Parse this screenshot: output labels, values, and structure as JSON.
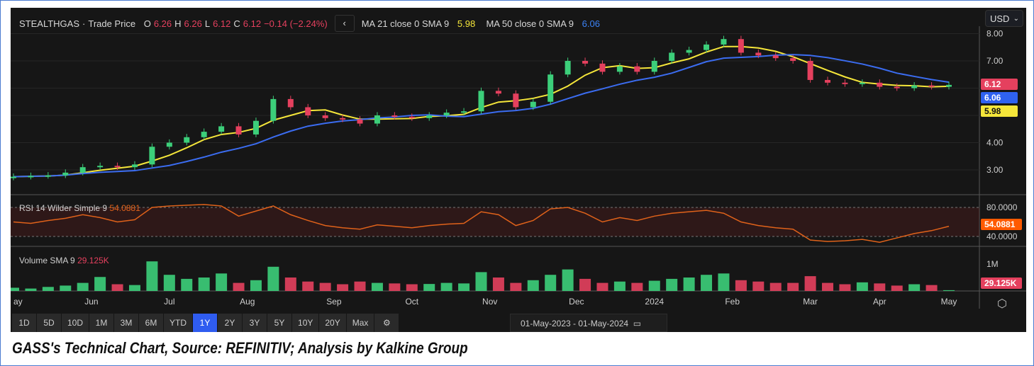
{
  "header": {
    "name": "STEALTHGAS",
    "sep": "·",
    "label": "Trade Price",
    "o_l": "O",
    "o": "6.26",
    "h_l": "H",
    "h": "6.26",
    "l_l": "L",
    "l": "6.12",
    "c_l": "C",
    "c": "6.12",
    "change": "−0.14 (−2.24%)",
    "ma21_label": "MA 21 close 0 SMA 9",
    "ma21_value": "5.98",
    "ma50_label": "MA 50 close 0 SMA 9",
    "ma50_value": "6.06"
  },
  "currency": "USD",
  "rsi": {
    "label": "RSI 14 Wilder Simple 9",
    "value": "54.0881"
  },
  "volume": {
    "label": "Volume SMA 9",
    "value": "29.125K"
  },
  "tags": {
    "price": "6.12",
    "ma50": "6.06",
    "ma21": "5.98"
  },
  "ranges": [
    "1D",
    "5D",
    "10D",
    "1M",
    "3M",
    "6M",
    "YTD",
    "1Y",
    "2Y",
    "3Y",
    "5Y",
    "10Y",
    "20Y",
    "Max"
  ],
  "active_range": "1Y",
  "date_range": "01-May-2023  -  01-May-2024",
  "caption": "GASS's Technical Chart, Source: REFINITIV; Analysis by Kalkine Group",
  "colors": {
    "up": "#3ccf7a",
    "down": "#e5405e",
    "ma21": "#f5e63a",
    "ma50": "#3b6cf0",
    "rsi": "#e0621a"
  },
  "chart_data": {
    "type": "candlestick",
    "price_axis": {
      "ticks": [
        "8.00",
        "7.00",
        "4.00",
        "3.00"
      ],
      "tick_values": [
        8,
        7,
        4,
        3
      ],
      "range": [
        2.6,
        8.05
      ]
    },
    "rsi_axis": {
      "ticks": [
        "80.0000",
        "40.0000"
      ],
      "tick_values": [
        80,
        40
      ]
    },
    "volume_axis": {
      "ticks": [
        "1M"
      ],
      "tick_values": [
        1000
      ]
    },
    "x_labels": [
      "ay",
      "Jun",
      "Jul",
      "Aug",
      "Sep",
      "Oct",
      "Nov",
      "Dec",
      "2024",
      "Feb",
      "Mar",
      "Apr",
      "May"
    ],
    "x_label_index": [
      0,
      4.5,
      9,
      13.5,
      18.5,
      23,
      27.5,
      32.5,
      37,
      41.5,
      46,
      50,
      54
    ],
    "closes": [
      2.75,
      2.78,
      2.8,
      2.9,
      3.1,
      3.15,
      3.1,
      3.2,
      3.85,
      4.0,
      4.2,
      4.4,
      4.6,
      4.3,
      4.8,
      5.6,
      5.3,
      5.0,
      4.9,
      4.85,
      4.7,
      5.0,
      4.95,
      4.9,
      5.0,
      5.1,
      5.15,
      5.9,
      5.8,
      5.3,
      5.5,
      6.5,
      7.0,
      6.9,
      6.6,
      6.8,
      6.6,
      7.0,
      7.3,
      7.4,
      7.6,
      7.8,
      7.3,
      7.2,
      7.1,
      7.0,
      6.3,
      6.2,
      6.15,
      6.2,
      6.05,
      6.0,
      6.1,
      6.05,
      6.12
    ],
    "rsi": [
      60,
      58,
      62,
      65,
      70,
      66,
      60,
      63,
      80,
      82,
      83,
      84,
      82,
      68,
      75,
      82,
      70,
      62,
      55,
      52,
      50,
      56,
      54,
      52,
      55,
      57,
      58,
      74,
      70,
      55,
      62,
      78,
      80,
      72,
      60,
      66,
      62,
      68,
      72,
      74,
      76,
      72,
      60,
      55,
      52,
      50,
      35,
      33,
      34,
      36,
      32,
      38,
      44,
      48,
      54
    ],
    "volume_k": [
      120,
      90,
      150,
      200,
      300,
      520,
      250,
      220,
      1100,
      600,
      450,
      500,
      650,
      300,
      400,
      900,
      500,
      350,
      300,
      250,
      350,
      300,
      280,
      250,
      260,
      300,
      280,
      700,
      500,
      300,
      400,
      600,
      800,
      450,
      300,
      350,
      300,
      380,
      450,
      500,
      600,
      650,
      400,
      350,
      300,
      300,
      550,
      300,
      250,
      320,
      280,
      200,
      250,
      220,
      29
    ]
  }
}
